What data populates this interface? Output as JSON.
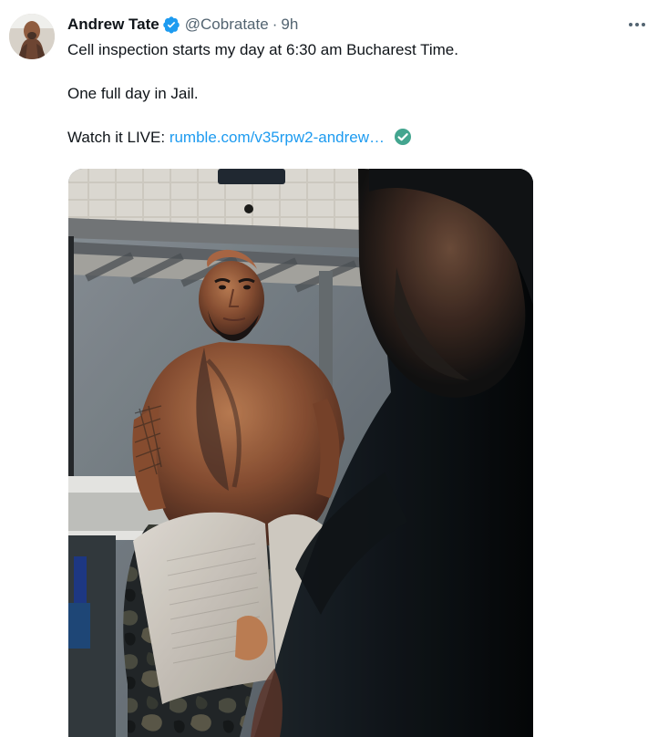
{
  "tweet": {
    "author_name": "Andrew Tate",
    "handle": "@Cobratate",
    "separator": "·",
    "time": "9h",
    "text_line_1": "Cell inspection starts my day at 6:30 am Bucharest Time.",
    "text_line_2": "One full day in Jail.",
    "text_line_3_prefix": "Watch it LIVE:",
    "link_text": "rumble.com/v35rpw2-andrew…"
  },
  "icons": {
    "verified": "verified-badge-icon",
    "more": "more-options-icon",
    "check": "green-check-emoji-icon"
  },
  "colors": {
    "text": "#0f1419",
    "secondary": "#536471",
    "link": "#1d9bf0",
    "verified": "#1d9bf0",
    "check": "#43a58f"
  }
}
